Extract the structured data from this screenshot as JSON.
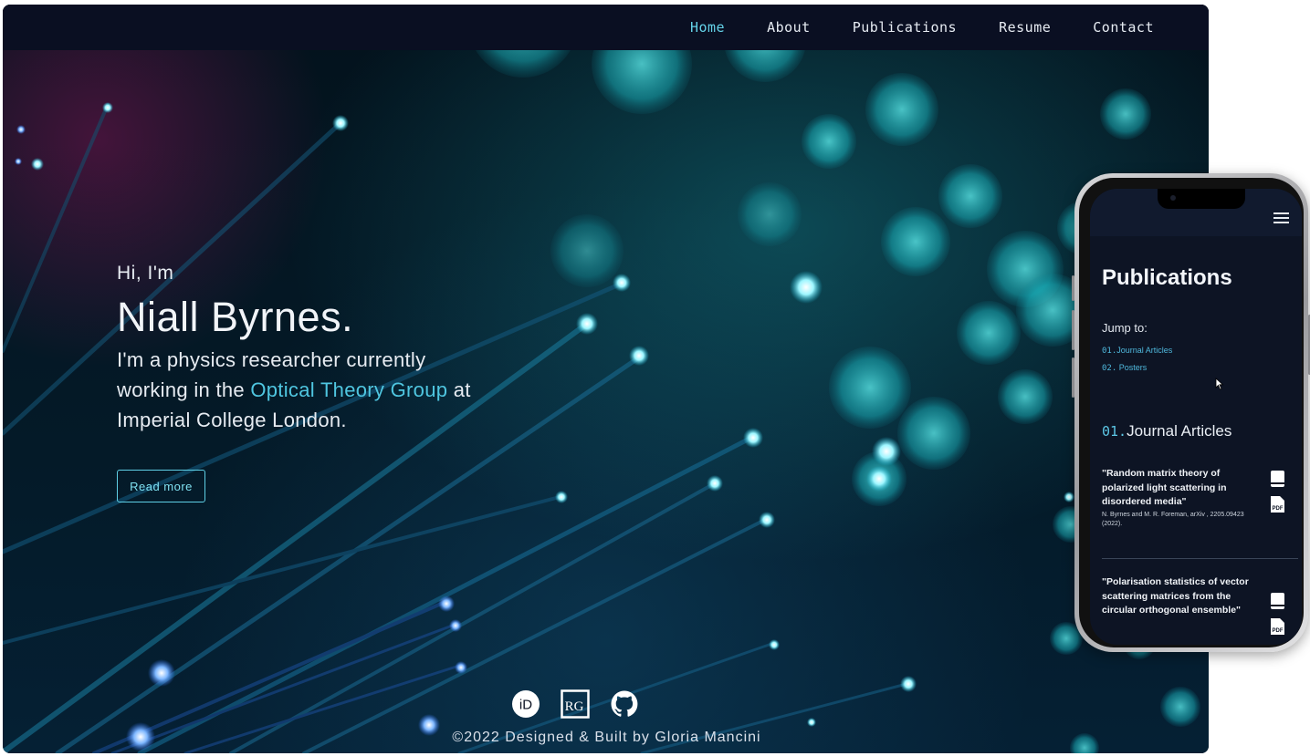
{
  "nav": {
    "items": [
      {
        "label": "Home",
        "active": true
      },
      {
        "label": "About",
        "active": false
      },
      {
        "label": "Publications",
        "active": false
      },
      {
        "label": "Resume",
        "active": false
      },
      {
        "label": "Contact",
        "active": false
      }
    ]
  },
  "hero": {
    "greeting": "Hi, I'm",
    "name": "Niall Byrnes.",
    "bio_before": "I'm a physics researcher currently working in the ",
    "bio_link": "Optical Theory Group",
    "bio_after": " at Imperial College London.",
    "cta_label": "Read more"
  },
  "socials": [
    {
      "icon": "orcid-icon",
      "text": "iD"
    },
    {
      "icon": "researchgate-icon",
      "text": "RG"
    },
    {
      "icon": "github-icon",
      "text": ""
    }
  ],
  "footer": {
    "text": "©2022 Designed & Built by Gloria Mancini"
  },
  "phone": {
    "title": "Publications",
    "jump_label": "Jump to:",
    "links": [
      {
        "num": "01.",
        "label": "Journal Articles"
      },
      {
        "num": "02.",
        "label": " Posters"
      }
    ],
    "section_num": "01.",
    "section_title": "Journal Articles",
    "publications": [
      {
        "title": "\"Random matrix theory of polarized light scattering in disordered media\"",
        "authors": "N. Byrnes and M. R. Foreman, arXiv , 2205.09423 (2022)."
      },
      {
        "title": "\"Polarisation statistics of vector scattering matrices from the circular orthogonal ensemble\"",
        "authors": ""
      }
    ],
    "pdf_label": "PDF"
  },
  "colors": {
    "accent": "#64d2e8",
    "nav_bg": "#0a0f22",
    "phone_bg": "#0d1424"
  }
}
